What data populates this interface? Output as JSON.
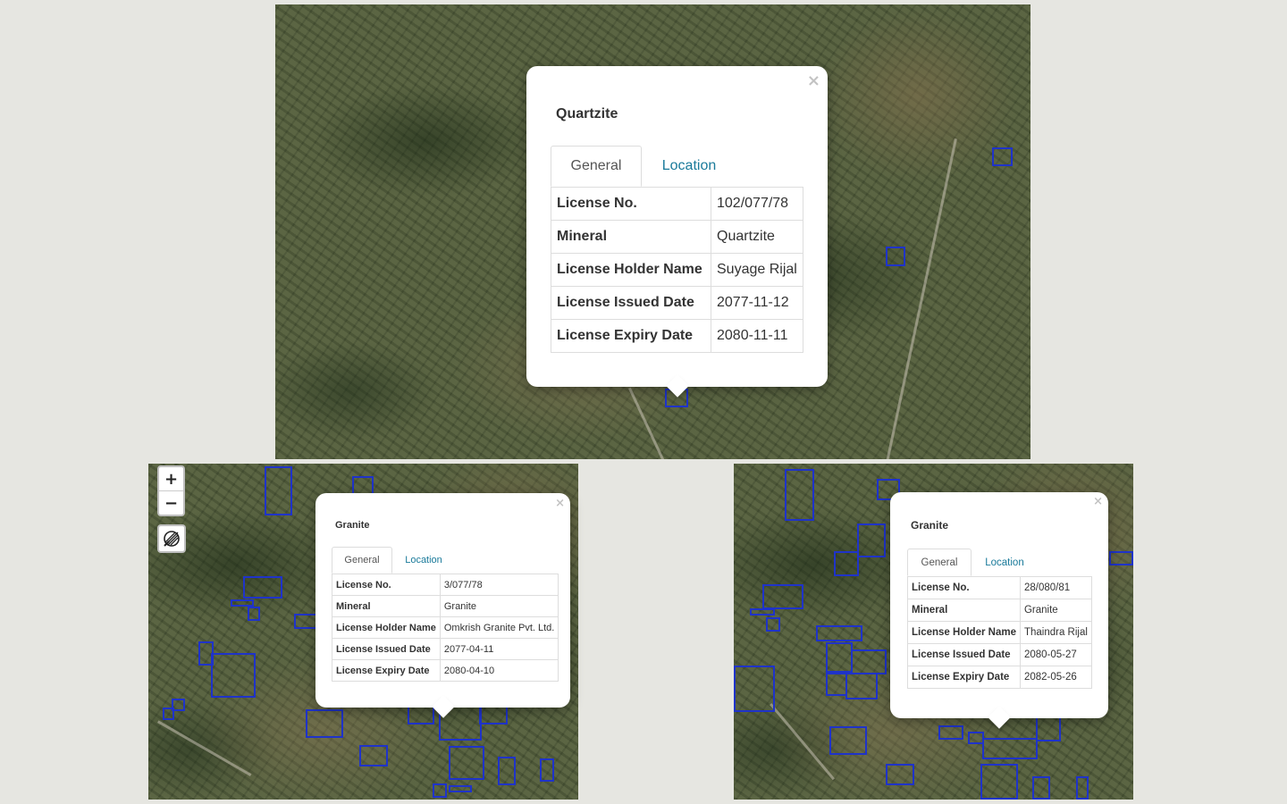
{
  "panels": {
    "top": {
      "popup": {
        "title": "Quartzite",
        "close": "×",
        "tabs": [
          "General",
          "Location"
        ],
        "rows": [
          {
            "label": "License No.",
            "value": "102/077/78"
          },
          {
            "label": "Mineral",
            "value": "Quartzite"
          },
          {
            "label": "License Holder Name",
            "value": "Suyage Rijal"
          },
          {
            "label": "License Issued Date",
            "value": "2077-11-12"
          },
          {
            "label": "License Expiry Date",
            "value": "2080-11-11"
          }
        ]
      }
    },
    "left": {
      "controls": {
        "zoom_in": "+",
        "zoom_out": "−"
      },
      "popup": {
        "title": "Granite",
        "close": "×",
        "tabs": [
          "General",
          "Location"
        ],
        "rows": [
          {
            "label": "License No.",
            "value": "3/077/78"
          },
          {
            "label": "Mineral",
            "value": "Granite"
          },
          {
            "label": "License Holder Name",
            "value": "Omkrish Granite Pvt. Ltd."
          },
          {
            "label": "License Issued Date",
            "value": "2077-04-11"
          },
          {
            "label": "License Expiry Date",
            "value": "2080-04-10"
          }
        ]
      }
    },
    "right": {
      "popup": {
        "title": "Granite",
        "close": "×",
        "tabs": [
          "General",
          "Location"
        ],
        "rows": [
          {
            "label": "License No.",
            "value": "28/080/81"
          },
          {
            "label": "Mineral",
            "value": "Granite"
          },
          {
            "label": "License Holder Name",
            "value": "Thaindra Rijal"
          },
          {
            "label": "License Issued Date",
            "value": "2080-05-27"
          },
          {
            "label": "License Expiry Date",
            "value": "2082-05-26"
          }
        ]
      }
    }
  },
  "colors": {
    "parcel_outline": "#1f33c9",
    "tab_link": "#1a7a9a",
    "background": "#e6e6e1"
  },
  "icons": {
    "layers": "layers-icon",
    "close": "close-icon"
  }
}
